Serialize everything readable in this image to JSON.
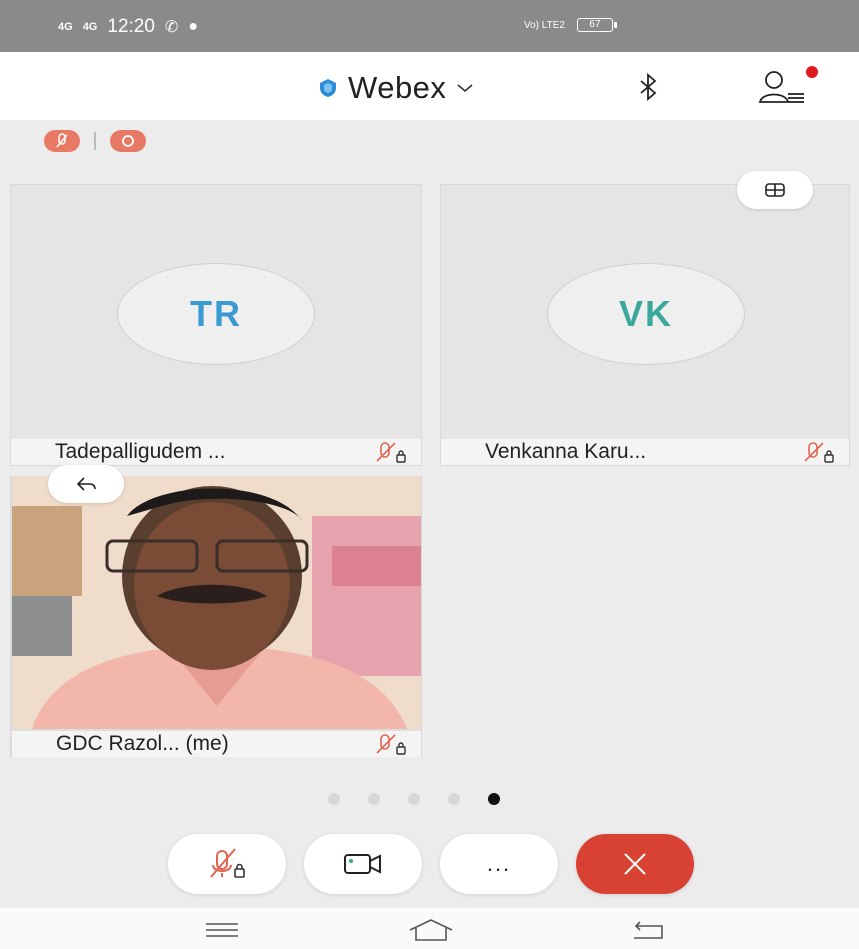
{
  "status_bar": {
    "signal1": "4G",
    "signal2": "4G",
    "time": "12:20",
    "network": "Vo) LTE2",
    "battery": "67"
  },
  "header": {
    "app_name": "Webex",
    "brand_color": "#2b8dd6",
    "notification_color": "#e0191f"
  },
  "participants": [
    {
      "initials": "TR",
      "name": "Tadepalligudem ...",
      "initials_color": "#3a9bd1",
      "muted": true
    },
    {
      "initials": "VK",
      "name": "Venkanna Karu...",
      "initials_color": "#3aa89a",
      "muted": true
    },
    {
      "initials": "",
      "name": "GDC Razol... (me)",
      "muted": true,
      "video": true
    }
  ],
  "page_indicator": {
    "total": 5,
    "active": 5
  },
  "controls": {
    "mute": "mic-muted-icon",
    "video": "video-camera-icon",
    "more": "...",
    "end": "end-call-icon",
    "end_color": "#d84232"
  },
  "icons": {
    "muted_color": "#e0664f"
  }
}
